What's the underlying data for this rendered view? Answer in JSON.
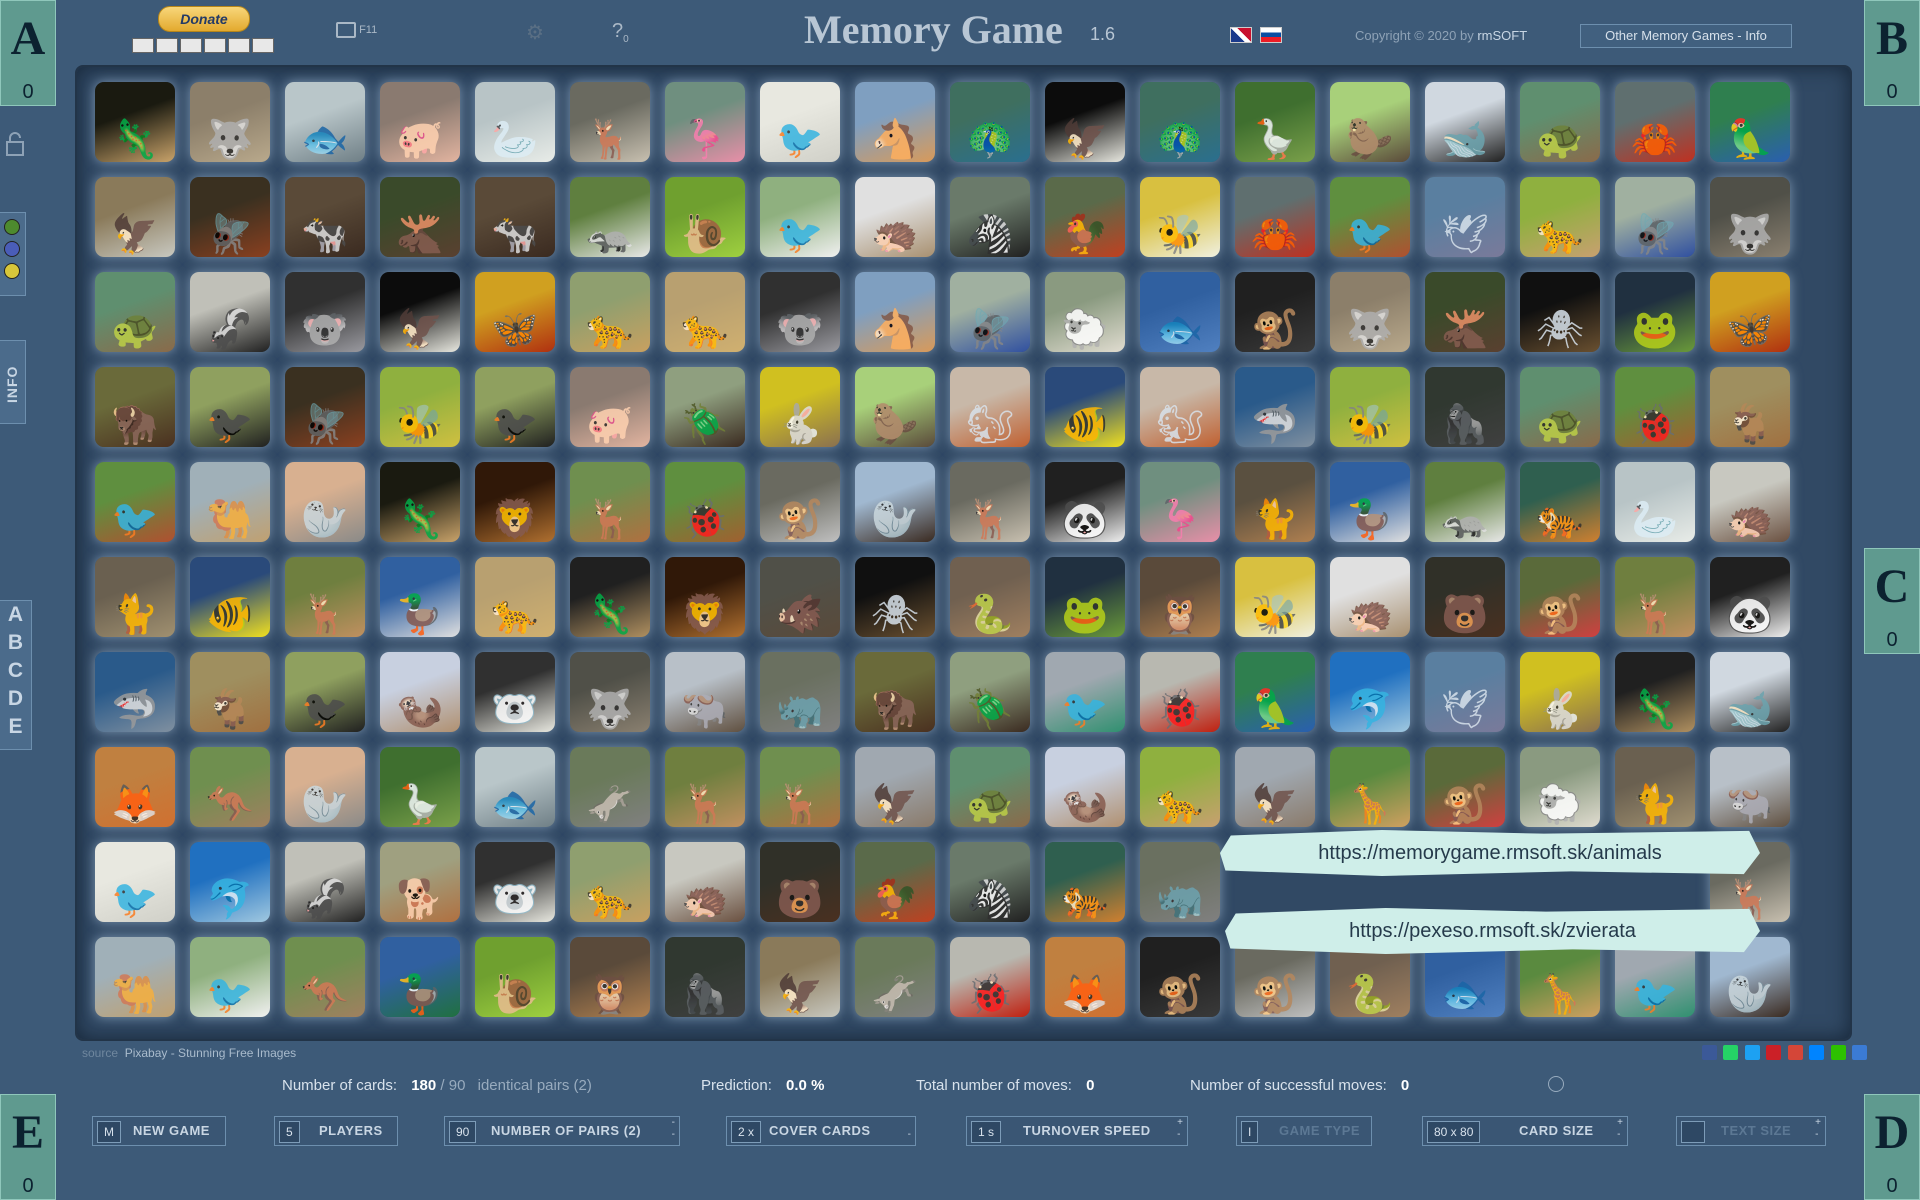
{
  "header": {
    "donate_label": "Donate",
    "fullscreen_label": "F11",
    "help_label": "?",
    "help_count": "0",
    "title": "Memory Game",
    "version": "1.6",
    "copyright": "Copyright © 2020 by",
    "copyright_owner": "rmSOFT",
    "other_games": "Other Memory Games - Info"
  },
  "players": [
    {
      "letter": "A",
      "score": "0"
    },
    {
      "letter": "B",
      "score": "0"
    },
    {
      "letter": "C",
      "score": "0"
    },
    {
      "letter": "D",
      "score": "0"
    },
    {
      "letter": "E",
      "score": "0"
    }
  ],
  "sidebar": {
    "info_label": "INFO",
    "letters": [
      "A",
      "B",
      "C",
      "D",
      "E"
    ],
    "colors": [
      "#4d8a2e",
      "#4a5db8",
      "#d7c63a"
    ]
  },
  "board": {
    "rows": 10,
    "cols": 18,
    "cards": [
      [
        "lizard",
        "hyena",
        "stingray",
        "pig",
        "swan",
        "deer",
        "flamingo",
        "swallow",
        "horse",
        "peacock",
        "eagle",
        "peacock",
        "goose",
        "beaver",
        "orca",
        "turtle",
        "crab",
        "parrot"
      ],
      [
        "hawk",
        "dragonfly",
        "cow",
        "moose",
        "cow",
        "badger",
        "snail",
        "stork",
        "hedgehog",
        "zebra",
        "rooster",
        "bee",
        "crab",
        "pheasant",
        "pigeon",
        "cougar",
        "fly",
        "wolf"
      ],
      [
        "turtle",
        "skunk",
        "koala",
        "eagle",
        "butterfly",
        "leopard",
        "cheetah",
        "koala",
        "horse",
        "fly",
        "sheep",
        "fish",
        "chimpanzee",
        "hyena",
        "moose",
        "spider",
        "frog",
        "butterfly"
      ],
      [
        "bison",
        "crow",
        "dragonfly",
        "wasp",
        "crow",
        "pig",
        "beetle",
        "rabbit",
        "beaver",
        "squirrel",
        "tropical-fish",
        "squirrel",
        "shark",
        "wasp",
        "gorilla",
        "turtle",
        "bug",
        "ibex"
      ],
      [
        "pheasant",
        "camel",
        "seal",
        "lizard",
        "lion",
        "antelope",
        "bug",
        "lemur",
        "walrus",
        "deer",
        "panda",
        "flamingo",
        "lynx",
        "duck",
        "badger",
        "tiger",
        "swan",
        "porcupine"
      ],
      [
        "cat",
        "tropical-fish",
        "fawn",
        "duck",
        "cheetah",
        "iguana",
        "lion",
        "boar",
        "spider",
        "snake",
        "frog",
        "owl",
        "bee",
        "hedgehog",
        "bear",
        "mandrill",
        "fawn",
        "panda"
      ],
      [
        "shark",
        "ibex",
        "crow",
        "meerkat",
        "polar-bear",
        "wolf",
        "wildebeest",
        "rhino",
        "bison",
        "beetle",
        "hummingbird",
        "ladybug",
        "parrot",
        "dolphin",
        "pigeon",
        "rabbit",
        "iguana",
        "orca"
      ],
      [
        "fox",
        "kangaroo",
        "seal",
        "goose",
        "stingray",
        "donkey",
        "fawn",
        "antelope",
        "falcon",
        "turtle",
        "meerkat",
        "cougar",
        "falcon",
        "giraffe",
        "mandrill",
        "sheep",
        "cat",
        "wildebeest"
      ],
      [
        "swallow",
        "dolphin",
        "skunk",
        "dog",
        "polar-bear",
        "leopard",
        "porcupine",
        "bear",
        "rooster",
        "zebra",
        "tiger",
        "rhino",
        "",
        "",
        "",
        "",
        "",
        "deer"
      ],
      [
        "camel",
        "stork",
        "kangaroo",
        "mallard",
        "snail",
        "owl",
        "gorilla",
        "hawk",
        "donkey",
        "ladybug",
        "fox",
        "chimpanzee",
        "lemur",
        "snake",
        "fish",
        "giraffe",
        "hummingbird",
        "walrus"
      ]
    ]
  },
  "banners": {
    "url1": "https://memorygame.rmsoft.sk/animals",
    "url2": "https://pexeso.rmsoft.sk/zvierata"
  },
  "source": {
    "label": "source",
    "value": "Pixabay - Stunning Free Images"
  },
  "stats": {
    "cards_label": "Number of cards:",
    "cards_value": "180",
    "cards_sep": "/ 90",
    "pairs_label": "identical pairs (2)",
    "prediction_label": "Prediction:",
    "prediction_value": "0.0 %",
    "moves_label": "Total number of moves:",
    "moves_value": "0",
    "success_label": "Number of successful moves:",
    "success_value": "0"
  },
  "controls": [
    {
      "value": "M",
      "label": "NEW GAME"
    },
    {
      "value": "5",
      "label": "PLAYERS"
    },
    {
      "value": "90",
      "label": "NUMBER OF PAIRS (2)"
    },
    {
      "value": "2 x",
      "label": "COVER CARDS"
    },
    {
      "value": "1 s",
      "label": "TURNOVER SPEED"
    },
    {
      "value": "I",
      "label": "GAME TYPE"
    },
    {
      "value": "80 x 80",
      "label": "CARD SIZE"
    },
    {
      "value": "",
      "label": "TEXT SIZE"
    }
  ]
}
